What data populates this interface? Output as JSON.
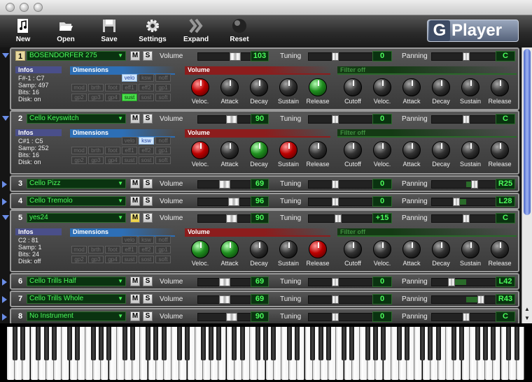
{
  "app": {
    "name_g": "G",
    "name_player": "Player"
  },
  "toolbar": [
    {
      "label": "New",
      "icon": "music-note-document-icon"
    },
    {
      "label": "Open",
      "icon": "open-folder-icon"
    },
    {
      "label": "Save",
      "icon": "floppy-disk-icon"
    },
    {
      "label": "Settings",
      "icon": "gear-icon"
    },
    {
      "label": "Expand",
      "icon": "double-chevron-icon"
    },
    {
      "label": "Reset",
      "icon": "reset-ball-icon"
    }
  ],
  "labels": {
    "volume": "Volume",
    "tuning": "Tuning",
    "panning": "Panning",
    "mute": "M",
    "solo": "S",
    "infos": "Infos",
    "dimensions": "Dimensions",
    "volume_section": "Volume",
    "filter": "Filter off"
  },
  "dim_buttons": [
    "velo",
    "ksw",
    "noff",
    "mod",
    "brth",
    "foot",
    "eff1",
    "eff2",
    "gp1",
    "gp2",
    "gp3",
    "gp4",
    "sust",
    "sost",
    "soft"
  ],
  "knob_labels": [
    "Veloc.",
    "Attack",
    "Decay",
    "Sustain",
    "Release",
    "Cutoff",
    "Veloc.",
    "Attack",
    "Decay",
    "Sustain",
    "Release"
  ],
  "channels": [
    {
      "num": "1",
      "instrument": "BOSENDORFER 275",
      "volume": "103",
      "volume_level": 0.68,
      "tuning": "0",
      "tuning_level": 0.5,
      "panning": "C",
      "pan_level": 0.5,
      "mute": false,
      "expanded": true,
      "info": [
        "F#-1 : C7",
        "Samp: 497",
        "Bits: 16",
        "Disk: on"
      ],
      "active_dims": [
        "velo",
        "sust"
      ],
      "knobs": [
        "red",
        "black",
        "black",
        "black",
        "green",
        "black",
        "black",
        "black",
        "black",
        "black",
        "black"
      ]
    },
    {
      "num": "2",
      "instrument": "Cello Keyswitch",
      "volume": "90",
      "volume_level": 0.6,
      "tuning": "0",
      "tuning_level": 0.5,
      "panning": "C",
      "pan_level": 0.5,
      "mute": false,
      "expanded": true,
      "info": [
        "C#1 : C5",
        "Samp: 252",
        "Bits: 16",
        "Disk: on"
      ],
      "active_dims": [
        "ksw"
      ],
      "knobs": [
        "red",
        "black",
        "green",
        "red",
        "black",
        "black",
        "black",
        "black",
        "black",
        "black",
        "black"
      ]
    },
    {
      "num": "3",
      "instrument": "Cello Pizz",
      "volume": "69",
      "volume_level": 0.45,
      "tuning": "0",
      "tuning_level": 0.5,
      "panning": "R25",
      "pan_level": 0.62,
      "mute": false,
      "expanded": false
    },
    {
      "num": "4",
      "instrument": "Cello Tremolo",
      "volume": "96",
      "volume_level": 0.65,
      "tuning": "0",
      "tuning_level": 0.5,
      "panning": "L28",
      "pan_level": 0.36,
      "mute": false,
      "expanded": false
    },
    {
      "num": "5",
      "instrument": "yes24",
      "volume": "90",
      "volume_level": 0.6,
      "tuning": "+15",
      "tuning_level": 0.55,
      "panning": "C",
      "pan_level": 0.5,
      "mute": true,
      "expanded": true,
      "info": [
        "C2 : 81",
        "Samp: 1",
        "Bits: 24",
        "Disk: off"
      ],
      "active_dims": [],
      "knobs": [
        "green",
        "green",
        "black",
        "black",
        "red",
        "black",
        "black",
        "black",
        "black",
        "black",
        "black"
      ]
    },
    {
      "num": "6",
      "instrument": "Cello Trills Half",
      "volume": "69",
      "volume_level": 0.45,
      "tuning": "0",
      "tuning_level": 0.5,
      "panning": "L42",
      "pan_level": 0.29,
      "mute": false,
      "expanded": false
    },
    {
      "num": "7",
      "instrument": "Cello Trills Whole",
      "volume": "69",
      "volume_level": 0.45,
      "tuning": "0",
      "tuning_level": 0.5,
      "panning": "R43",
      "pan_level": 0.71,
      "mute": false,
      "expanded": false
    },
    {
      "num": "8",
      "instrument": "No Instrument",
      "volume": "90",
      "volume_level": 0.6,
      "tuning": "0",
      "tuning_level": 0.5,
      "panning": "C",
      "pan_level": 0.5,
      "mute": false,
      "expanded": false
    }
  ]
}
